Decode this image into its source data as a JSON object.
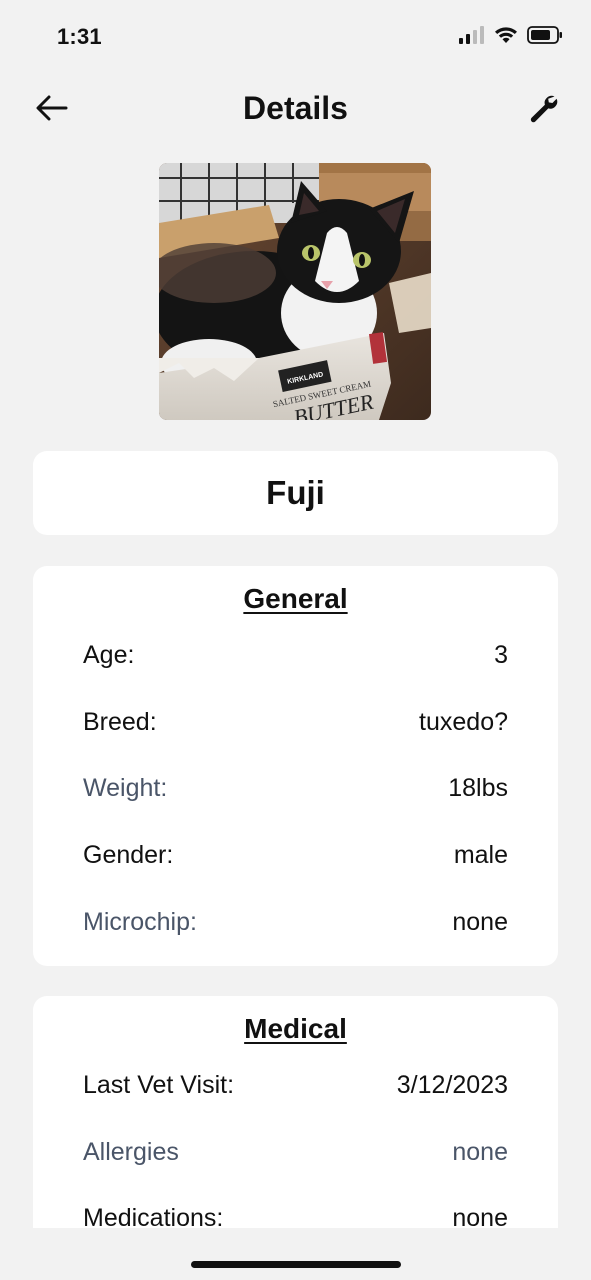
{
  "status_bar": {
    "time": "1:31",
    "icons": [
      "cellular-signal-icon",
      "wifi-icon",
      "battery-icon"
    ]
  },
  "nav": {
    "title": "Details",
    "back_icon": "arrow-left-icon",
    "settings_icon": "wrench-icon"
  },
  "pet": {
    "name": "Fuji",
    "photo_description": "black and white tuxedo cat sitting in a cardboard box"
  },
  "general": {
    "title": "General",
    "rows": [
      {
        "label": "Age:",
        "value": "3"
      },
      {
        "label": "Breed:",
        "value": "tuxedo?"
      },
      {
        "label": "Weight:",
        "value": "18lbs"
      },
      {
        "label": "Gender:",
        "value": "male"
      },
      {
        "label": "Microchip:",
        "value": "none"
      }
    ]
  },
  "medical": {
    "title": "Medical",
    "rows": [
      {
        "label": "Last Vet Visit:",
        "value": "3/12/2023"
      },
      {
        "label": "Allergies",
        "value": "none"
      },
      {
        "label": "Medications:",
        "value": "none"
      }
    ]
  },
  "box_print": {
    "brand": "KIRKLAND",
    "line1": "SALTED SWEET CREAM",
    "line2": "BUTTER"
  },
  "colors": {
    "background": "#f2f2f2",
    "card": "#ffffff",
    "muted_text": "#4a5568",
    "text": "#111111"
  }
}
